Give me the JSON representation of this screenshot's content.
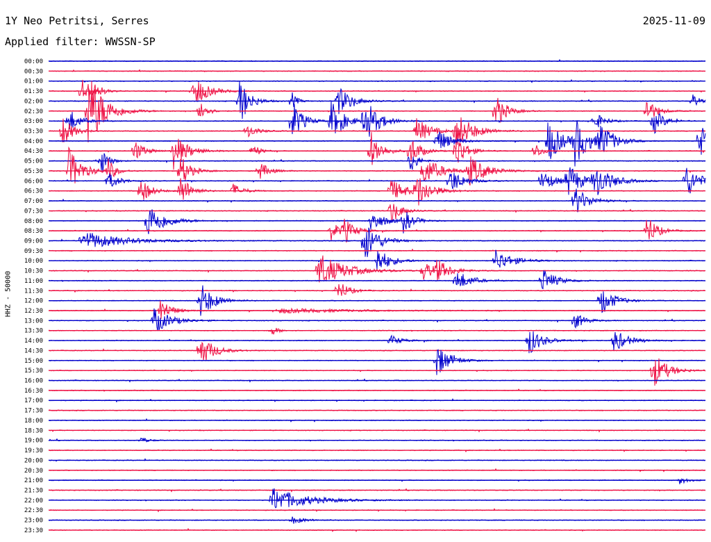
{
  "header": {
    "station": "1Y Neo Petritsi, Serres",
    "date": "2025-11-09",
    "filter": "Applied filter: WWSSN-SP"
  },
  "chart_data": {
    "type": "line",
    "ylabel": "HHZ - 50000",
    "trace_colors": [
      "#0000cc",
      "#ee1144"
    ],
    "rows": [
      "00:00",
      "00:30",
      "01:00",
      "01:30",
      "02:00",
      "02:30",
      "03:00",
      "03:30",
      "04:00",
      "04:30",
      "05:00",
      "05:30",
      "06:00",
      "06:30",
      "07:00",
      "07:30",
      "08:00",
      "08:30",
      "09:00",
      "09:30",
      "10:00",
      "10:30",
      "11:00",
      "11:30",
      "12:00",
      "12:30",
      "13:00",
      "13:30",
      "14:00",
      "14:30",
      "15:00",
      "15:30",
      "16:00",
      "16:30",
      "17:00",
      "17:30",
      "18:00",
      "18:30",
      "19:00",
      "19:30",
      "20:00",
      "20:30",
      "21:00",
      "21:30",
      "22:00",
      "22:30",
      "23:00",
      "23:30"
    ],
    "row_minutes": 30,
    "events": [
      {
        "row": 3,
        "t": 0.05,
        "amp": 1.4,
        "dur": 0.03
      },
      {
        "row": 3,
        "t": 0.07,
        "amp": 0.7,
        "dur": 0.02
      },
      {
        "row": 3,
        "t": 0.22,
        "amp": 1.8,
        "dur": 0.04
      },
      {
        "row": 4,
        "t": 0.29,
        "amp": 2.6,
        "dur": 0.03
      },
      {
        "row": 4,
        "t": 0.37,
        "amp": 1.0,
        "dur": 0.015
      },
      {
        "row": 4,
        "t": 0.44,
        "amp": 1.6,
        "dur": 0.04
      },
      {
        "row": 4,
        "t": 0.98,
        "amp": 0.8,
        "dur": 0.02
      },
      {
        "row": 5,
        "t": 0.06,
        "amp": 4.0,
        "dur": 0.05
      },
      {
        "row": 5,
        "t": 0.23,
        "amp": 1.5,
        "dur": 0.02
      },
      {
        "row": 5,
        "t": 0.68,
        "amp": 2.0,
        "dur": 0.03
      },
      {
        "row": 5,
        "t": 0.91,
        "amp": 1.4,
        "dur": 0.03
      },
      {
        "row": 6,
        "t": 0.03,
        "amp": 1.4,
        "dur": 0.03
      },
      {
        "row": 6,
        "t": 0.37,
        "amp": 2.4,
        "dur": 0.03
      },
      {
        "row": 6,
        "t": 0.43,
        "amp": 2.0,
        "dur": 0.04
      },
      {
        "row": 6,
        "t": 0.48,
        "amp": 2.5,
        "dur": 0.04
      },
      {
        "row": 6,
        "t": 0.83,
        "amp": 1.0,
        "dur": 0.03
      },
      {
        "row": 6,
        "t": 0.92,
        "amp": 1.5,
        "dur": 0.03
      },
      {
        "row": 7,
        "t": 0.02,
        "amp": 1.8,
        "dur": 0.03
      },
      {
        "row": 7,
        "t": 0.3,
        "amp": 0.8,
        "dur": 0.03
      },
      {
        "row": 7,
        "t": 0.56,
        "amp": 1.4,
        "dur": 0.04
      },
      {
        "row": 7,
        "t": 0.62,
        "amp": 2.0,
        "dur": 0.05
      },
      {
        "row": 8,
        "t": 0.59,
        "amp": 1.4,
        "dur": 0.04
      },
      {
        "row": 8,
        "t": 0.76,
        "amp": 2.4,
        "dur": 0.04
      },
      {
        "row": 8,
        "t": 0.8,
        "amp": 2.6,
        "dur": 0.04
      },
      {
        "row": 8,
        "t": 0.84,
        "amp": 1.8,
        "dur": 0.04
      },
      {
        "row": 8,
        "t": 0.99,
        "amp": 2.0,
        "dur": 0.03
      },
      {
        "row": 9,
        "t": 0.13,
        "amp": 1.2,
        "dur": 0.03
      },
      {
        "row": 9,
        "t": 0.19,
        "amp": 2.0,
        "dur": 0.04
      },
      {
        "row": 9,
        "t": 0.31,
        "amp": 0.9,
        "dur": 0.02
      },
      {
        "row": 9,
        "t": 0.49,
        "amp": 2.2,
        "dur": 0.03
      },
      {
        "row": 9,
        "t": 0.55,
        "amp": 1.6,
        "dur": 0.03
      },
      {
        "row": 9,
        "t": 0.62,
        "amp": 2.0,
        "dur": 0.03
      },
      {
        "row": 9,
        "t": 0.74,
        "amp": 1.0,
        "dur": 0.02
      },
      {
        "row": 10,
        "t": 0.08,
        "amp": 1.6,
        "dur": 0.02
      },
      {
        "row": 10,
        "t": 0.55,
        "amp": 1.6,
        "dur": 0.02
      },
      {
        "row": 11,
        "t": 0.03,
        "amp": 2.4,
        "dur": 0.04
      },
      {
        "row": 11,
        "t": 0.09,
        "amp": 1.4,
        "dur": 0.02
      },
      {
        "row": 11,
        "t": 0.2,
        "amp": 1.8,
        "dur": 0.03
      },
      {
        "row": 11,
        "t": 0.32,
        "amp": 1.0,
        "dur": 0.03
      },
      {
        "row": 11,
        "t": 0.57,
        "amp": 1.6,
        "dur": 0.05
      },
      {
        "row": 11,
        "t": 0.64,
        "amp": 1.6,
        "dur": 0.05
      },
      {
        "row": 12,
        "t": 0.09,
        "amp": 1.0,
        "dur": 0.03
      },
      {
        "row": 12,
        "t": 0.61,
        "amp": 1.4,
        "dur": 0.04
      },
      {
        "row": 12,
        "t": 0.75,
        "amp": 1.2,
        "dur": 0.04
      },
      {
        "row": 12,
        "t": 0.79,
        "amp": 1.8,
        "dur": 0.04
      },
      {
        "row": 12,
        "t": 0.83,
        "amp": 1.8,
        "dur": 0.05
      },
      {
        "row": 12,
        "t": 0.97,
        "amp": 1.8,
        "dur": 0.04
      },
      {
        "row": 13,
        "t": 0.14,
        "amp": 1.4,
        "dur": 0.03
      },
      {
        "row": 13,
        "t": 0.2,
        "amp": 1.8,
        "dur": 0.03
      },
      {
        "row": 13,
        "t": 0.28,
        "amp": 0.8,
        "dur": 0.03
      },
      {
        "row": 13,
        "t": 0.52,
        "amp": 1.2,
        "dur": 0.05
      },
      {
        "row": 13,
        "t": 0.56,
        "amp": 1.8,
        "dur": 0.04
      },
      {
        "row": 14,
        "t": 0.8,
        "amp": 1.6,
        "dur": 0.04
      },
      {
        "row": 15,
        "t": 0.52,
        "amp": 1.4,
        "dur": 0.03
      },
      {
        "row": 16,
        "t": 0.15,
        "amp": 2.0,
        "dur": 0.05
      },
      {
        "row": 16,
        "t": 0.49,
        "amp": 1.2,
        "dur": 0.04
      },
      {
        "row": 16,
        "t": 0.54,
        "amp": 1.2,
        "dur": 0.03
      },
      {
        "row": 17,
        "t": 0.43,
        "amp": 1.0,
        "dur": 0.03
      },
      {
        "row": 17,
        "t": 0.45,
        "amp": 1.2,
        "dur": 0.03
      },
      {
        "row": 17,
        "t": 0.91,
        "amp": 1.8,
        "dur": 0.03
      },
      {
        "row": 18,
        "t": 0.05,
        "amp": 1.0,
        "dur": 0.12
      },
      {
        "row": 18,
        "t": 0.48,
        "amp": 2.4,
        "dur": 0.04
      },
      {
        "row": 20,
        "t": 0.5,
        "amp": 1.4,
        "dur": 0.04
      },
      {
        "row": 20,
        "t": 0.68,
        "amp": 1.2,
        "dur": 0.05
      },
      {
        "row": 21,
        "t": 0.41,
        "amp": 1.8,
        "dur": 0.08
      },
      {
        "row": 21,
        "t": 0.57,
        "amp": 1.0,
        "dur": 0.04
      },
      {
        "row": 21,
        "t": 0.59,
        "amp": 1.0,
        "dur": 0.04
      },
      {
        "row": 22,
        "t": 0.62,
        "amp": 1.2,
        "dur": 0.04
      },
      {
        "row": 22,
        "t": 0.75,
        "amp": 1.4,
        "dur": 0.04
      },
      {
        "row": 23,
        "t": 0.44,
        "amp": 1.2,
        "dur": 0.03
      },
      {
        "row": 24,
        "t": 0.23,
        "amp": 2.0,
        "dur": 0.04
      },
      {
        "row": 24,
        "t": 0.84,
        "amp": 1.6,
        "dur": 0.04
      },
      {
        "row": 25,
        "t": 0.17,
        "amp": 1.4,
        "dur": 0.03
      },
      {
        "row": 25,
        "t": 0.35,
        "amp": 0.25,
        "dur": 0.2
      },
      {
        "row": 26,
        "t": 0.16,
        "amp": 1.4,
        "dur": 0.05
      },
      {
        "row": 26,
        "t": 0.8,
        "amp": 1.0,
        "dur": 0.03
      },
      {
        "row": 27,
        "t": 0.34,
        "amp": 0.5,
        "dur": 0.02
      },
      {
        "row": 28,
        "t": 0.52,
        "amp": 0.6,
        "dur": 0.03
      },
      {
        "row": 28,
        "t": 0.73,
        "amp": 1.6,
        "dur": 0.04
      },
      {
        "row": 28,
        "t": 0.86,
        "amp": 1.3,
        "dur": 0.04
      },
      {
        "row": 29,
        "t": 0.23,
        "amp": 1.8,
        "dur": 0.04
      },
      {
        "row": 30,
        "t": 0.59,
        "amp": 1.8,
        "dur": 0.04
      },
      {
        "row": 31,
        "t": 0.92,
        "amp": 2.0,
        "dur": 0.04
      },
      {
        "row": 38,
        "t": 0.14,
        "amp": 0.4,
        "dur": 0.02
      },
      {
        "row": 42,
        "t": 0.96,
        "amp": 0.5,
        "dur": 0.02
      },
      {
        "row": 44,
        "t": 0.34,
        "amp": 1.3,
        "dur": 0.1
      },
      {
        "row": 46,
        "t": 0.37,
        "amp": 0.4,
        "dur": 0.04
      }
    ]
  }
}
